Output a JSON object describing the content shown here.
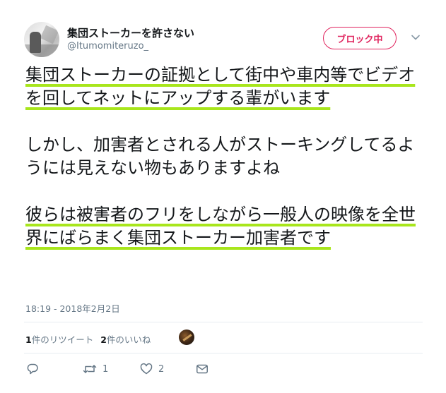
{
  "author": {
    "display_name": "集団ストーカーを許さない",
    "handle": "@Itumomiteruzo_"
  },
  "follow_button": {
    "label": "ブロック中"
  },
  "tweet": {
    "paragraphs": [
      "集団ストーカーの証拠として街中や車内等でビデオを回してネットにアップする輩がいます",
      "しかし、加害者とされる人がストーキングしてるようには見えない物もありますよね",
      "彼らは被害者のフリをしながら一般人の映像を全世界にばらまく集団ストーカー加害者です"
    ],
    "timestamp": "18:19 - 2018年2月2日"
  },
  "stats": {
    "retweets_count": "1",
    "retweets_label": "件のリツイート",
    "likes_count": "2",
    "likes_label": "件のいいね"
  },
  "actions": {
    "retweet_count": "1",
    "like_count": "2"
  },
  "icons": {
    "reply": "reply-icon",
    "retweet": "retweet-icon",
    "like": "heart-icon",
    "dm": "envelope-icon",
    "more": "chevron-down-icon"
  },
  "colors": {
    "block_red": "#e0245e",
    "highlight_green": "#a8e61c",
    "muted_gray": "#657786"
  }
}
